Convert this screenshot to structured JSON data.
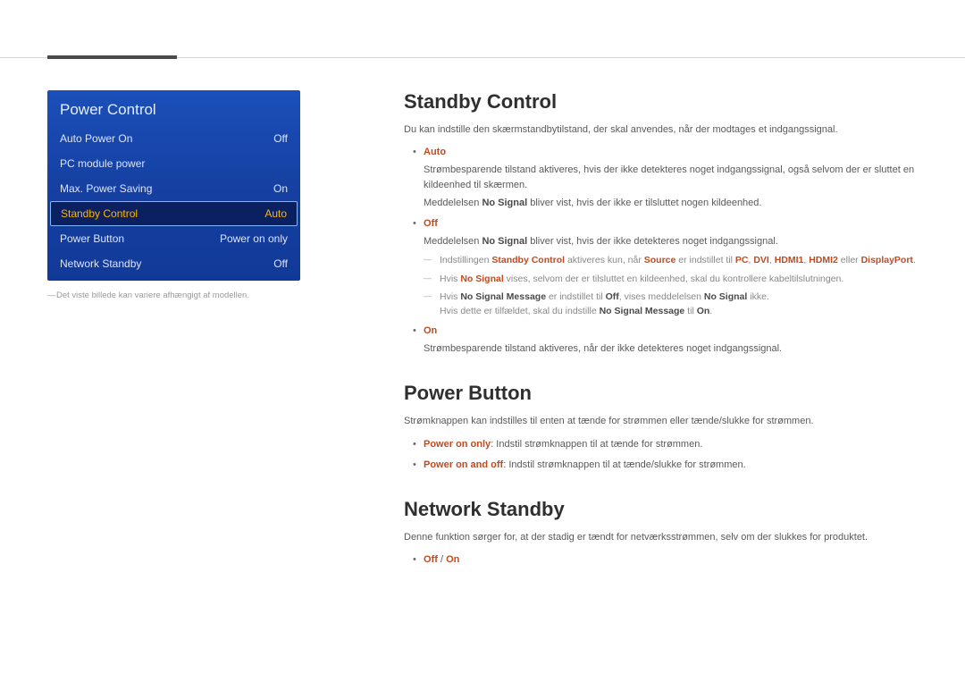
{
  "osd": {
    "title": "Power Control",
    "rows": [
      {
        "label": "Auto Power On",
        "value": "Off",
        "selected": false
      },
      {
        "label": "PC module power",
        "value": "",
        "selected": false
      },
      {
        "label": "Max. Power Saving",
        "value": "On",
        "selected": false
      },
      {
        "label": "Standby Control",
        "value": "Auto",
        "selected": true
      },
      {
        "label": "Power Button",
        "value": "Power on only",
        "selected": false
      },
      {
        "label": "Network Standby",
        "value": "Off",
        "selected": false
      }
    ],
    "footnote_dash": "―",
    "footnote": "Det viste billede kan variere afhængigt af modellen."
  },
  "section1": {
    "heading": "Standby Control",
    "intro": "Du kan indstille den skærmstandbytilstand, der skal anvendes, når der modtages et indgangssignal.",
    "auto_label": "Auto",
    "auto_para1": "Strømbesparende tilstand aktiveres, hvis der ikke detekteres noget indgangssignal, også selvom der er sluttet en kildeenhed til skærmen.",
    "auto_para2_a": "Meddelelsen ",
    "auto_para2_b": "No Signal",
    "auto_para2_c": " bliver vist, hvis der ikke er tilsluttet nogen kildeenhed.",
    "off_label": "Off",
    "off_para1_a": "Meddelelsen ",
    "off_para1_b": "No Signal",
    "off_para1_c": " bliver vist, hvis der ikke detekteres noget indgangssignal.",
    "off_sub1_a": "Indstillingen ",
    "off_sub1_b": "Standby Control",
    "off_sub1_c": " aktiveres kun, når ",
    "off_sub1_d": "Source",
    "off_sub1_e": " er indstillet til ",
    "off_sub1_f": "PC",
    "off_sub1_g": ", ",
    "off_sub1_h": "DVI",
    "off_sub1_i": ", ",
    "off_sub1_j": "HDMI1",
    "off_sub1_k": ", ",
    "off_sub1_l": "HDMI2",
    "off_sub1_m": " eller ",
    "off_sub1_n": "DisplayPort",
    "off_sub1_o": ".",
    "off_sub2_a": "Hvis ",
    "off_sub2_b": "No Signal",
    "off_sub2_c": " vises, selvom der er tilsluttet en kildeenhed, skal du kontrollere kabeltilslutningen.",
    "off_sub3_a": "Hvis ",
    "off_sub3_b": "No Signal Message",
    "off_sub3_c": " er indstillet til ",
    "off_sub3_d": "Off",
    "off_sub3_e": ", vises meddelelsen ",
    "off_sub3_f": "No Signal",
    "off_sub3_g": " ikke.",
    "off_sub3_line2_a": "Hvis dette er tilfældet, skal du indstille ",
    "off_sub3_line2_b": "No Signal Message",
    "off_sub3_line2_c": " til ",
    "off_sub3_line2_d": "On",
    "off_sub3_line2_e": ".",
    "on_label": "On",
    "on_para": "Strømbesparende tilstand aktiveres, når der ikke detekteres noget indgangssignal."
  },
  "section2": {
    "heading": "Power Button",
    "intro": "Strømknappen kan indstilles til enten at tænde for strømmen eller tænde/slukke for strømmen.",
    "b1_label": "Power on only",
    "b1_text": ": Indstil strømknappen til at tænde for strømmen.",
    "b2_label": "Power on and off",
    "b2_text": ": Indstil strømknappen til at tænde/slukke for strømmen."
  },
  "section3": {
    "heading": "Network Standby",
    "intro": "Denne funktion sørger for, at der stadig er tændt for netværksstrømmen, selv om der slukkes for produktet.",
    "opts_a": "Off",
    "opts_sep": " / ",
    "opts_b": "On"
  }
}
